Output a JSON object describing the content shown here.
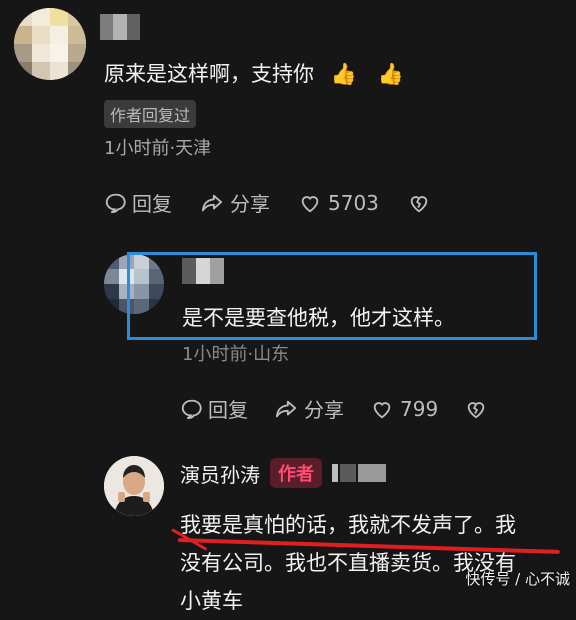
{
  "comment1": {
    "text": "原来是这样啊，支持你",
    "emoji": "👍",
    "badge": "作者回复过",
    "meta": "1小时前·天津",
    "reply_label": "回复",
    "share_label": "分享",
    "likes": "5703"
  },
  "comment2": {
    "text": "是不是要查他税，他才这样。",
    "meta": "1小时前·山东",
    "reply_label": "回复",
    "share_label": "分享",
    "likes": "799"
  },
  "comment3": {
    "username": "演员孙涛",
    "author_badge": "作者",
    "line1": "我要是真怕的话，我就不发声了。我",
    "line2": "没有公司。我也不直播卖货。我没有",
    "line3": "小黄车"
  },
  "watermark": "快传号 / 心不诚",
  "colors": {
    "highlight_box": "#2a8fd8",
    "underline": "#e02020",
    "author_badge": "#ff4b6e"
  }
}
